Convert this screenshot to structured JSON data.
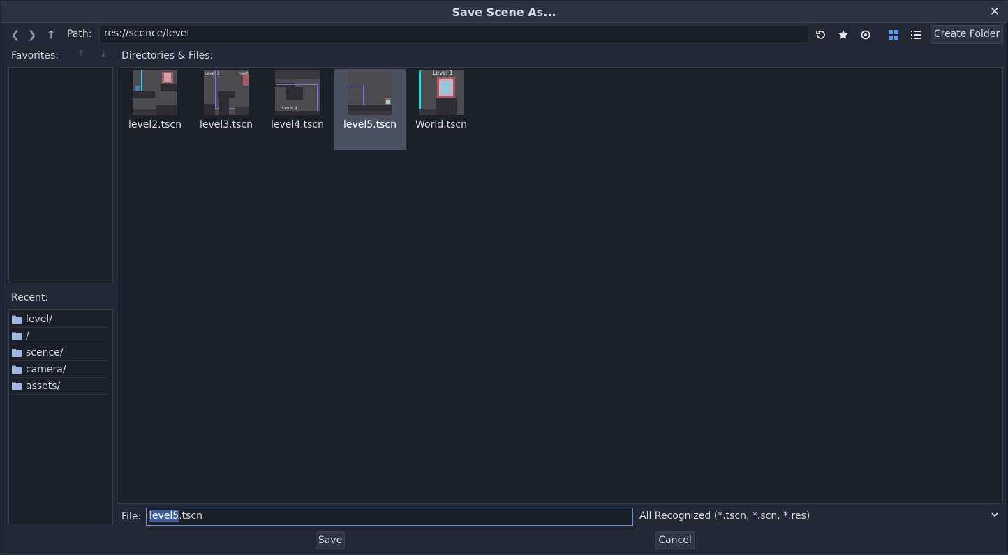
{
  "dialog": {
    "title": "Save Scene As..."
  },
  "toolbar": {
    "path_label": "Path:",
    "path_value": "res://scence/level",
    "create_folder_label": "Create Folder"
  },
  "favorites": {
    "label": "Favorites:"
  },
  "recent": {
    "label": "Recent:",
    "items": [
      {
        "label": "level/"
      },
      {
        "label": "/"
      },
      {
        "label": "scence/"
      },
      {
        "label": "camera/"
      },
      {
        "label": "assets/"
      }
    ]
  },
  "files": {
    "label": "Directories & Files:",
    "items": [
      {
        "label": "level2.tscn",
        "selected": false
      },
      {
        "label": "level3.tscn",
        "selected": false
      },
      {
        "label": "level4.tscn",
        "selected": false
      },
      {
        "label": "level5.tscn",
        "selected": true
      },
      {
        "label": "World.tscn",
        "selected": false
      }
    ],
    "thumb_texts": {
      "level3": "Level 3",
      "level4": "Level 4",
      "world": "Level 1",
      "next": "next"
    }
  },
  "bottom": {
    "file_label": "File:",
    "file_value_selected": "level5",
    "file_value_rest": ".tscn",
    "filter_value": "All Recognized (*.tscn, *.scn, *.res)",
    "save_label": "Save",
    "cancel_label": "Cancel"
  },
  "colors": {
    "background": "#232834",
    "panel": "#1c2029",
    "selected_tile": "#4a5160",
    "accent": "#5f9ae8"
  }
}
